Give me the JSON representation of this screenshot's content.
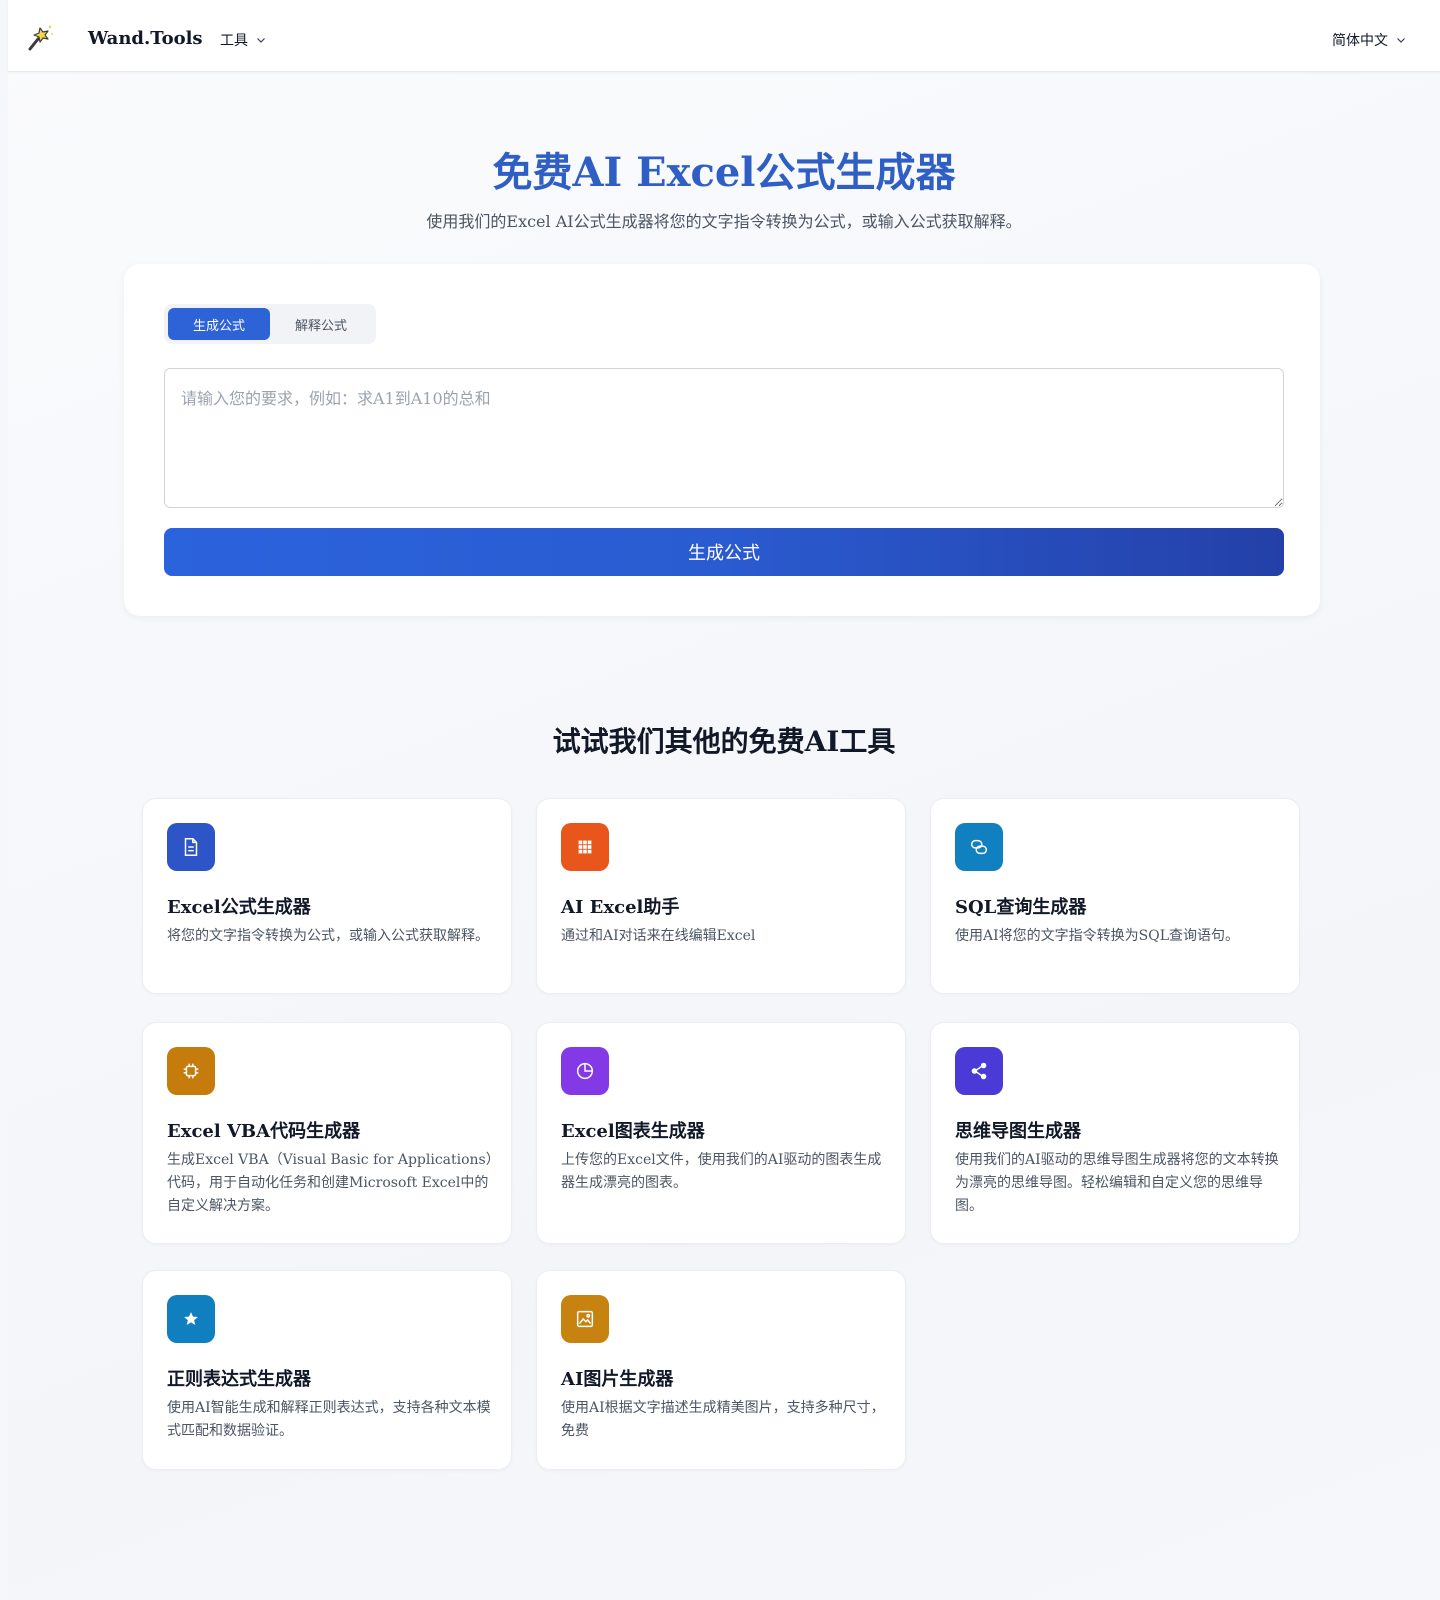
{
  "header": {
    "brand": "Wand.Tools",
    "tools_menu": "工具",
    "language": "简体中文"
  },
  "hero": {
    "title": "免费AI Excel公式生成器",
    "subtitle": "使用我们的Excel AI公式生成器将您的文字指令转换为公式，或输入公式获取解释。"
  },
  "form": {
    "tabs": [
      "生成公式",
      "解释公式"
    ],
    "active_tab": 0,
    "input_placeholder": "请输入您的要求，例如：求A1到A10的总和",
    "input_value": "",
    "submit_label": "生成公式"
  },
  "colors": {
    "title_blue": "#2f5fc4",
    "primary": "#2e63d8"
  },
  "other_tools": {
    "heading": "试试我们其他的免费AI工具",
    "items": [
      {
        "name": "Excel公式生成器",
        "desc": "将您的文字指令转换为公式，或输入公式获取解释。",
        "icon": "document-icon",
        "color": "#2d55c8"
      },
      {
        "name": "AI Excel助手",
        "desc": "通过和AI对话来在线编辑Excel",
        "icon": "grid-icon",
        "color": "#e8561c"
      },
      {
        "name": "SQL查询生成器",
        "desc": "使用AI将您的文字指令转换为SQL查询语句。",
        "icon": "chat-icon",
        "color": "#1180c0"
      },
      {
        "name": "Excel VBA代码生成器",
        "desc": "生成Excel VBA（Visual Basic for Applications）代码，用于自动化任务和创建Microsoft Excel中的自定义解决方案。",
        "icon": "chip-icon",
        "color": "#c67c0c"
      },
      {
        "name": "Excel图表生成器",
        "desc": "上传您的Excel文件，使用我们的AI驱动的图表生成器生成漂亮的图表。",
        "icon": "pie-chart-icon",
        "color": "#8439e6"
      },
      {
        "name": "思维导图生成器",
        "desc": "使用我们的AI驱动的思维导图生成器将您的文本转换为漂亮的思维导图。轻松编辑和自定义您的思维导图。",
        "icon": "share-icon",
        "color": "#4b3ad6"
      },
      {
        "name": "正则表达式生成器",
        "desc": "使用AI智能生成和解释正则表达式，支持各种文本模式匹配和数据验证。",
        "icon": "star-icon",
        "color": "#0f7fc0"
      },
      {
        "name": "AI图片生成器",
        "desc": "使用AI根据文字描述生成精美图片，支持多种尺寸，免费",
        "icon": "image-icon",
        "color": "#c68310"
      }
    ]
  }
}
